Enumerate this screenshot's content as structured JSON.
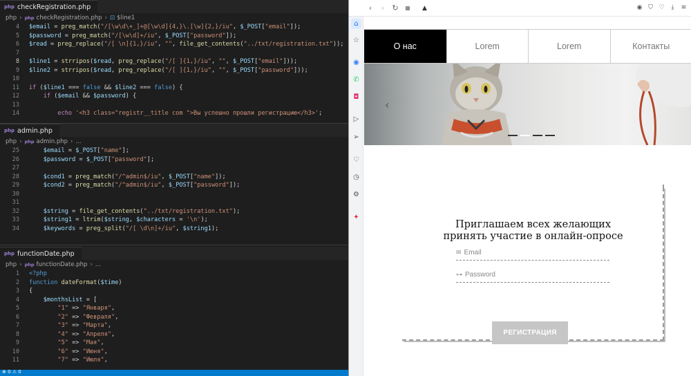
{
  "editor": {
    "panes": [
      {
        "tab": "checkRegistration.php",
        "breadcrumb": [
          "php",
          "checkRegistration.php",
          "$line1"
        ],
        "lines": [
          {
            "n": "4",
            "t": "$email = preg_match(\"/[\\w\\d\\+_]+@[\\w\\d]{4,}\\.[\\w]{2,}/iu\", $_POST[\"email\"]);"
          },
          {
            "n": "5",
            "t": "$password = preg_match(\"/[\\w\\d]+/iu\", $_POST[\"password\"]);"
          },
          {
            "n": "6",
            "t": "$read = preg_replace(\"/[ \\n]{1,}/iu\", \"\", file_get_contents(\"../txt/registration.txt\"));"
          },
          {
            "n": "7",
            "t": ""
          },
          {
            "n": "8",
            "t": "$line1 = strripos($read, preg_replace(\"/[ ]{1,}/iu\", \"\", $_POST[\"email\"]));"
          },
          {
            "n": "9",
            "t": "$line2 = strripos($read, preg_replace(\"/[ ]{1,}/iu\", \"\", $_POST[\"password\"]));"
          },
          {
            "n": "10",
            "t": ""
          },
          {
            "n": "11",
            "t": "if ($line1 === false && $line2 === false) {"
          },
          {
            "n": "12",
            "t": "    if ($email && $password) {"
          },
          {
            "n": "13",
            "t": ""
          },
          {
            "n": "14",
            "t": "        echo '<h3 class=\"registr__title com \">Вы успешно прошли регистрацию</h3>';"
          }
        ]
      },
      {
        "tab": "admin.php",
        "breadcrumb": [
          "php",
          "admin.php",
          "..."
        ],
        "lines": [
          {
            "n": "25",
            "t": "    $email = $_POST[\"name\"];"
          },
          {
            "n": "26",
            "t": "    $password = $_POST[\"password\"];"
          },
          {
            "n": "27",
            "t": ""
          },
          {
            "n": "28",
            "t": "    $cond1 = preg_match(\"/^admin$/iu\", $_POST[\"name\"]);"
          },
          {
            "n": "29",
            "t": "    $cond2 = preg_match(\"/^admin$/iu\", $_POST[\"password\"]);"
          },
          {
            "n": "30",
            "t": ""
          },
          {
            "n": "31",
            "t": ""
          },
          {
            "n": "32",
            "t": "    $string = file_get_contents(\"../txt/registration.txt\");"
          },
          {
            "n": "33",
            "t": "    $string1 = ltrim($string, $characters = '\\n');"
          },
          {
            "n": "34",
            "t": "    $keywords = preg_split(\"/[ \\d\\n]+/iu\", $string1);"
          }
        ]
      },
      {
        "tab": "functionDate.php",
        "breadcrumb": [
          "php",
          "functionDate.php",
          "..."
        ],
        "lines": [
          {
            "n": "1",
            "t": "<?php"
          },
          {
            "n": "2",
            "t": "function dateFormat($time)"
          },
          {
            "n": "3",
            "t": "{"
          },
          {
            "n": "4",
            "t": "    $monthsList = ["
          },
          {
            "n": "5",
            "t": "        \"1\" => \"Января\","
          },
          {
            "n": "6",
            "t": "        \"2\" => \"Февраля\","
          },
          {
            "n": "7",
            "t": "        \"3\" => \"Марта\","
          },
          {
            "n": "8",
            "t": "        \"4\" => \"Апреля\","
          },
          {
            "n": "9",
            "t": "        \"5\" => \"Мая\","
          },
          {
            "n": "10",
            "t": "        \"6\" => \"Июня\","
          },
          {
            "n": "11",
            "t": "        \"7\" => \"Июля\","
          }
        ]
      }
    ],
    "status": "⊗ 0 ⚠ 0"
  },
  "browser": {
    "site": {
      "nav": [
        "О нас",
        "Lorem",
        "Lorem",
        "Контакты"
      ],
      "hero_prev": "‹",
      "form": {
        "title_line1": "Приглашаем всех желающих",
        "title_line2": "принять участие в онлайн-опросе",
        "email_placeholder": "Email",
        "password_placeholder": "Password",
        "submit": "РЕГИСТРАЦИЯ"
      }
    }
  }
}
